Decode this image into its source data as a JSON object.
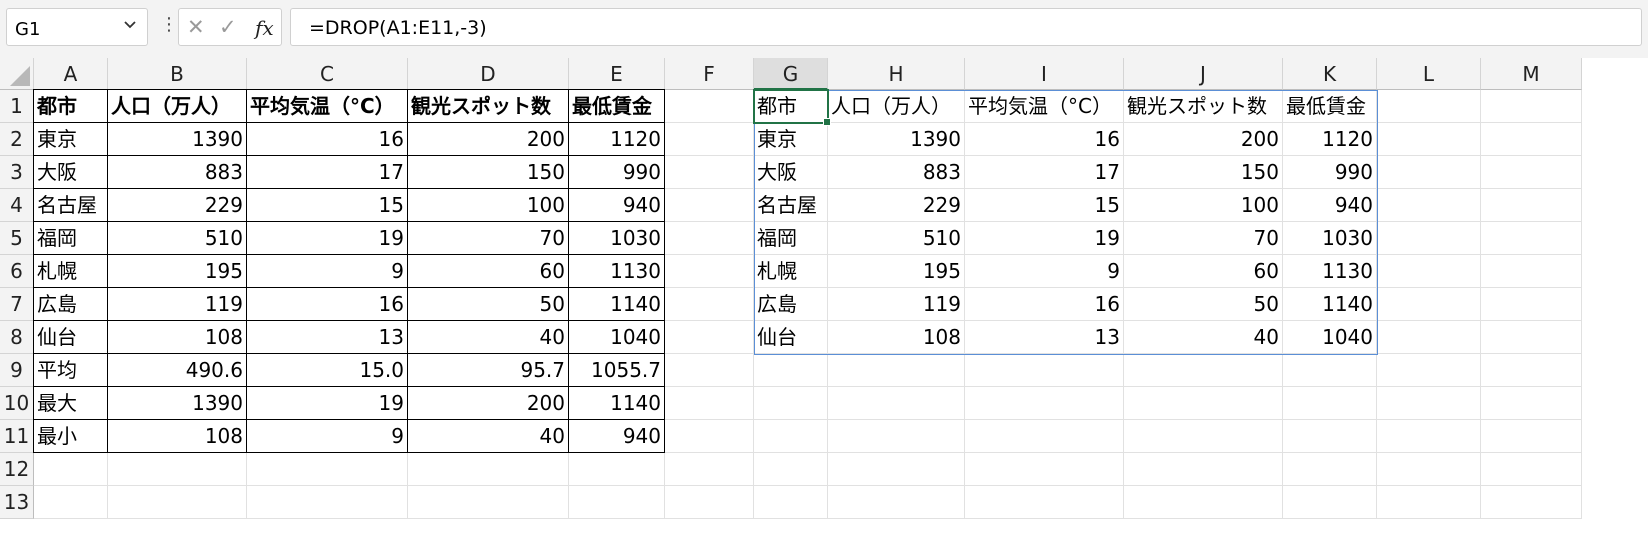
{
  "formula_bar": {
    "name_box": "G1",
    "name_box_chevron": "chevron-down-icon",
    "more_icon": "⋮",
    "cancel_icon": "✕",
    "enter_icon": "✓",
    "fx_label": "fx",
    "formula": "=DROP(A1:E11,-3)"
  },
  "columns": [
    "A",
    "B",
    "C",
    "D",
    "E",
    "F",
    "G",
    "H",
    "I",
    "J",
    "K",
    "L",
    "M"
  ],
  "rows": [
    "1",
    "2",
    "3",
    "4",
    "5",
    "6",
    "7",
    "8",
    "9",
    "10",
    "11",
    "12",
    "13"
  ],
  "active_cell": "G1",
  "source_table": {
    "headers": [
      "都市",
      "人口（万人）",
      "平均気温（°C）",
      "観光スポット数",
      "最低賃金"
    ],
    "rows": [
      [
        "東京",
        "1390",
        "16",
        "200",
        "1120"
      ],
      [
        "大阪",
        "883",
        "17",
        "150",
        "990"
      ],
      [
        "名古屋",
        "229",
        "15",
        "100",
        "940"
      ],
      [
        "福岡",
        "510",
        "19",
        "70",
        "1030"
      ],
      [
        "札幌",
        "195",
        "9",
        "60",
        "1130"
      ],
      [
        "広島",
        "119",
        "16",
        "50",
        "1140"
      ],
      [
        "仙台",
        "108",
        "13",
        "40",
        "1040"
      ],
      [
        "平均",
        "490.6",
        "15.0",
        "95.7",
        "1055.7"
      ],
      [
        "最大",
        "1390",
        "19",
        "200",
        "1140"
      ],
      [
        "最小",
        "108",
        "9",
        "40",
        "940"
      ]
    ]
  },
  "spill_table": {
    "headers": [
      "都市",
      "人口（万人）",
      "平均気温（°C）",
      "観光スポット数",
      "最低賃金"
    ],
    "rows": [
      [
        "東京",
        "1390",
        "16",
        "200",
        "1120"
      ],
      [
        "大阪",
        "883",
        "17",
        "150",
        "990"
      ],
      [
        "名古屋",
        "229",
        "15",
        "100",
        "940"
      ],
      [
        "福岡",
        "510",
        "19",
        "70",
        "1030"
      ],
      [
        "札幌",
        "195",
        "9",
        "60",
        "1130"
      ],
      [
        "広島",
        "119",
        "16",
        "50",
        "1140"
      ],
      [
        "仙台",
        "108",
        "13",
        "40",
        "1040"
      ]
    ]
  },
  "colors": {
    "selection": "#217346",
    "spill_border": "#5b8fd6",
    "header_bg": "#f3f3f3"
  }
}
